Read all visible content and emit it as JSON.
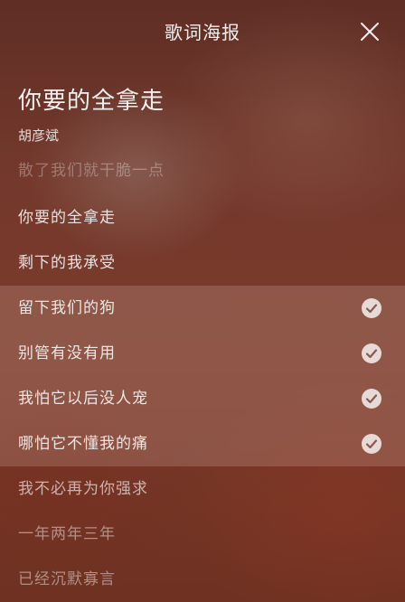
{
  "header": {
    "title": "歌词海报",
    "close_icon": "close-icon"
  },
  "song": {
    "title": "你要的全拿走",
    "artist": "胡彦斌"
  },
  "lyrics": [
    {
      "text": "散了我们就干脆一点",
      "selected": false
    },
    {
      "text": "你要的全拿走",
      "selected": false
    },
    {
      "text": "剩下的我承受",
      "selected": false
    },
    {
      "text": "留下我们的狗",
      "selected": true
    },
    {
      "text": "别管有没有用",
      "selected": true
    },
    {
      "text": "我怕它以后没人宠",
      "selected": true
    },
    {
      "text": "哪怕它不懂我的痛",
      "selected": true
    },
    {
      "text": "我不必再为你强求",
      "selected": false
    },
    {
      "text": "一年两年三年",
      "selected": false
    },
    {
      "text": "已经沉默寡言",
      "selected": false
    }
  ],
  "colors": {
    "background": "#6b3328",
    "selected_band": "rgba(235,205,195,0.20)",
    "check_fill": "#d9cfcc"
  }
}
